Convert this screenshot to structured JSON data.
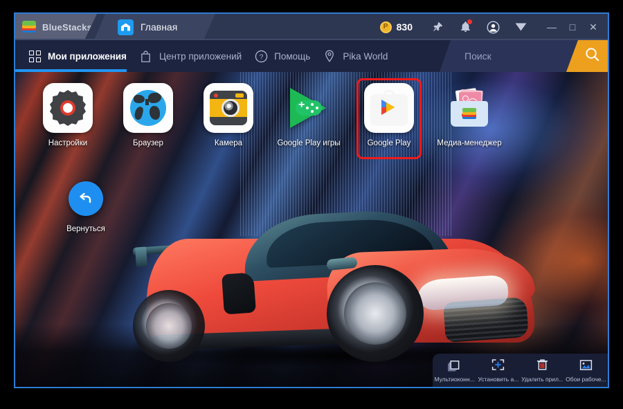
{
  "titlebar": {
    "brand": "BlueStacks",
    "brand_logo_icon": "bluestacks-logo-icon",
    "tab_home_label": "Главная",
    "tab_home_icon": "home-icon",
    "coin_symbol": "P",
    "coin_value": "830",
    "icons": [
      {
        "name": "pin-icon",
        "label": "pin"
      },
      {
        "name": "bell-icon",
        "label": "notifications",
        "badge": true
      },
      {
        "name": "account-icon",
        "label": "account"
      },
      {
        "name": "chevron-down-icon",
        "label": "more"
      }
    ],
    "window_buttons": {
      "minimize": "—",
      "maximize": "□",
      "close": "✕"
    }
  },
  "navbar": {
    "items": [
      {
        "label": "Мои приложения",
        "icon": "grid-icon",
        "active": true
      },
      {
        "label": "Центр приложений",
        "icon": "bag-icon",
        "active": false
      },
      {
        "label": "Помощь",
        "icon": "question-circle-icon",
        "active": false
      },
      {
        "label": "Pika World",
        "icon": "map-pin-icon",
        "active": false
      }
    ],
    "search": {
      "placeholder": "Поиск",
      "button_icon": "search-icon",
      "accent": "#eda01e"
    }
  },
  "desktop": {
    "apps": [
      {
        "label": "Настройки",
        "icon": "settings-gear-icon",
        "highlighted": false
      },
      {
        "label": "Браузер",
        "icon": "browser-globe-icon",
        "highlighted": false
      },
      {
        "label": "Камера",
        "icon": "camera-icon",
        "highlighted": false
      },
      {
        "label": "Google Play игры",
        "icon": "google-play-games-icon",
        "highlighted": false
      },
      {
        "label": "Google Play",
        "icon": "google-play-store-icon",
        "highlighted": true
      },
      {
        "label": "Медиа-менеджер",
        "icon": "media-manager-icon",
        "highlighted": false
      }
    ],
    "back_button": {
      "label": "Вернуться",
      "icon": "back-arrow-icon"
    },
    "highlight_color": "#f01b1b"
  },
  "bottombar": {
    "items": [
      {
        "label": "Мультиоконн...",
        "icon": "multi-window-icon"
      },
      {
        "label": "Установить а...",
        "icon": "install-apk-icon"
      },
      {
        "label": "Удалить прил...",
        "icon": "trash-icon"
      },
      {
        "label": "Обои рабоче...",
        "icon": "wallpaper-icon"
      }
    ]
  }
}
